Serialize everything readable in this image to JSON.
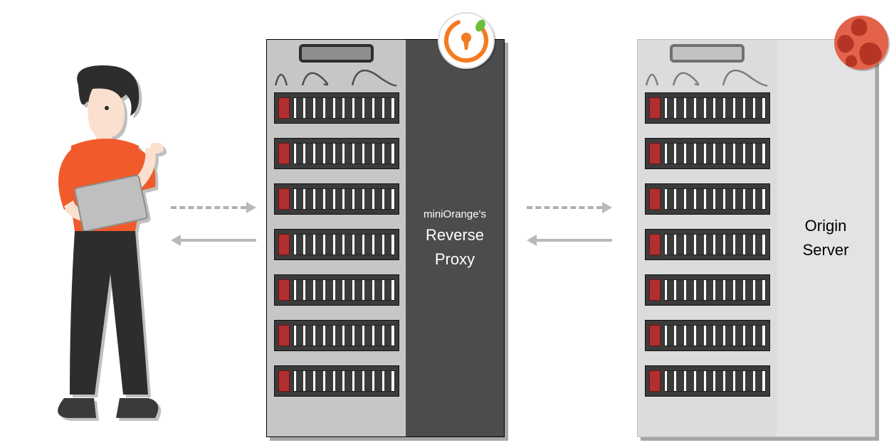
{
  "diagram": {
    "actors": {
      "user": {
        "name": "user-with-tablet"
      },
      "proxy": {
        "label_pre": "miniOrange's",
        "label_main1": "Reverse",
        "label_main2": "Proxy",
        "badge": "miniorange-lock-icon"
      },
      "origin": {
        "label_main1": "Origin",
        "label_main2": "Server",
        "badge": "globe-icon"
      }
    },
    "flows": [
      {
        "from": "user",
        "to": "proxy",
        "style": "dashed",
        "direction": "right"
      },
      {
        "from": "proxy",
        "to": "user",
        "style": "solid",
        "direction": "left"
      },
      {
        "from": "proxy",
        "to": "origin",
        "style": "dashed",
        "direction": "right"
      },
      {
        "from": "origin",
        "to": "proxy",
        "style": "solid",
        "direction": "left"
      }
    ],
    "drives_per_rack": 7
  }
}
